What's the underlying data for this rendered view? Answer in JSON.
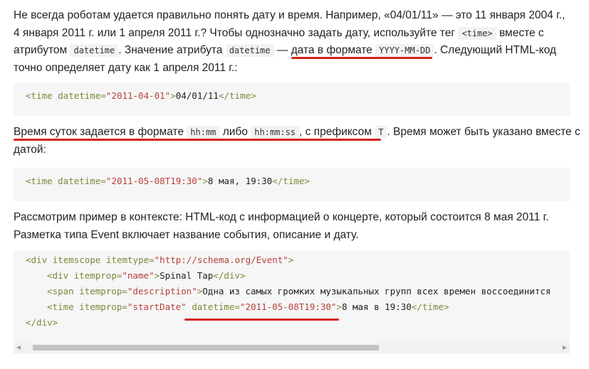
{
  "p1": {
    "l1": "Не всегда роботам удается правильно понять дату и время. Например, «04/01/11» — это 11 января 2004 г.,",
    "l2a": "4 января 2011 г. или 1 апреля 2011 г.? Чтобы однозначно задать дату, используйте тег ",
    "l2code": "<time>",
    "l2b": " вместе с",
    "l3a": "атрибутом ",
    "l3code1": "datetime",
    "l3b": ". Значение атрибута ",
    "l3code2": "datetime",
    "l3c": " — дата в формате ",
    "l3code3": "YYYY-MM-DD",
    "l3d": ". Следующий HTML-код",
    "l4": "точно определяет дату как 1 апреля 2011 г.:"
  },
  "code1": {
    "open": "<time ",
    "attr": "datetime=",
    "val": "\"2011-04-01\"",
    "close": ">",
    "text": "04/01/11",
    "end": "</time>"
  },
  "p2": {
    "l1a": "Время суток задается в формате ",
    "code1": "hh:mm",
    "l1b": " либо ",
    "code2": "hh:mm:ss",
    "l1c": ", с префиксом ",
    "code3": "T",
    "l1d": ". Время может быть указано вместе с",
    "l2": "датой:"
  },
  "code2": {
    "open": "<time ",
    "attr": "datetime=",
    "val": "\"2011-05-08T19:30\"",
    "close": ">",
    "text": "8 мая, 19:30",
    "end": "</time>"
  },
  "p3": {
    "l1": "Рассмотрим пример в контексте: HTML-код с информацией о концерте, который состоится 8 мая 2011 г.",
    "l2": "Разметка типа Event включает название события, описание и дату."
  },
  "code3": {
    "r1_open": "<div ",
    "r1_attr1": "itemscope itemtype=",
    "r1_val": "\"http://schema.org/Event\"",
    "r1_close": ">",
    "r2_open": "<div ",
    "r2_attr": "itemprop=",
    "r2_val": "\"name\"",
    "r2_close": ">",
    "r2_text": "Spinal Tap",
    "r2_end": "</div>",
    "r3_open": "<span ",
    "r3_attr": "itemprop=",
    "r3_val": "\"description\"",
    "r3_close": ">",
    "r3_text": "Одна из самых громких музыкальных групп всех времен воссоединится",
    "r4_open": "<time ",
    "r4_attr1": "itemprop=",
    "r4_val1": "\"startDate\"",
    "r4_attr2": "datetime=",
    "r4_val2": "\"2011-05-08T19:30\"",
    "r4_close": ">",
    "r4_text": "8 мая в 19:30",
    "r4_end": "</time>",
    "r5": "</div>"
  },
  "scrollbar": {
    "left_arrow": "◀",
    "right_arrow": "▶"
  },
  "colors": {
    "underline": "#d9201a",
    "tag": "#7a8a3a",
    "value": "#b5413b",
    "code_bg": "#f6f6f6"
  }
}
